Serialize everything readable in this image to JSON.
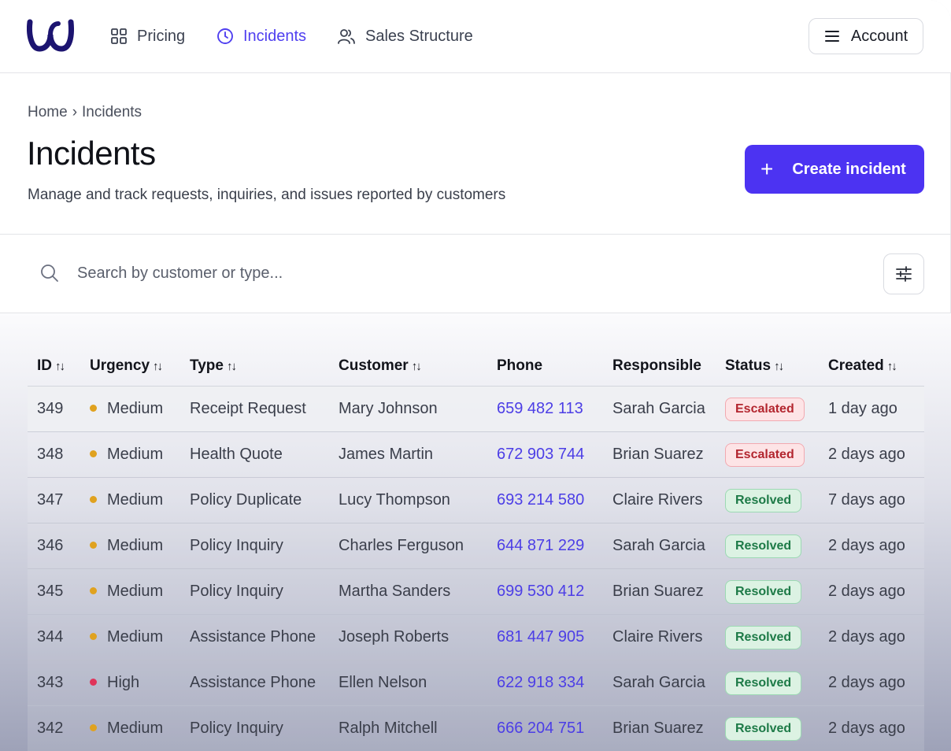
{
  "nav": {
    "items": [
      {
        "label": "Pricing",
        "icon": "grid-icon",
        "active": false
      },
      {
        "label": "Incidents",
        "icon": "clock-icon",
        "active": true
      },
      {
        "label": "Sales Structure",
        "icon": "users-icon",
        "active": false
      }
    ],
    "account_label": "Account"
  },
  "breadcrumb": {
    "home": "Home",
    "separator": "›",
    "current": "Incidents"
  },
  "page": {
    "title": "Incidents",
    "subtitle": "Manage and track requests, inquiries, and issues reported by customers",
    "create_label": "Create incident"
  },
  "search": {
    "placeholder": "Search by customer or type..."
  },
  "table": {
    "columns": {
      "id": "ID",
      "urgency": "Urgency",
      "type": "Type",
      "customer": "Customer",
      "phone": "Phone",
      "responsible": "Responsible",
      "status": "Status",
      "created": "Created"
    },
    "rows": [
      {
        "id": "349",
        "urgency": "Medium",
        "type": "Receipt Request",
        "customer": "Mary Johnson",
        "phone": "659 482 113",
        "responsible": "Sarah Garcia",
        "status": "Escalated",
        "created": "1 day ago"
      },
      {
        "id": "348",
        "urgency": "Medium",
        "type": "Health Quote",
        "customer": "James Martin",
        "phone": "672 903 744",
        "responsible": "Brian Suarez",
        "status": "Escalated",
        "created": "2 days ago"
      },
      {
        "id": "347",
        "urgency": "Medium",
        "type": "Policy Duplicate",
        "customer": "Lucy Thompson",
        "phone": "693 214 580",
        "responsible": "Claire Rivers",
        "status": "Resolved",
        "created": "7 days ago"
      },
      {
        "id": "346",
        "urgency": "Medium",
        "type": "Policy Inquiry",
        "customer": "Charles Ferguson",
        "phone": "644 871 229",
        "responsible": "Sarah Garcia",
        "status": "Resolved",
        "created": "2 days ago"
      },
      {
        "id": "345",
        "urgency": "Medium",
        "type": "Policy Inquiry",
        "customer": "Martha Sanders",
        "phone": "699 530 412",
        "responsible": "Brian Suarez",
        "status": "Resolved",
        "created": "2 days ago"
      },
      {
        "id": "344",
        "urgency": "Medium",
        "type": "Assistance Phone",
        "customer": "Joseph Roberts",
        "phone": "681 447 905",
        "responsible": "Claire Rivers",
        "status": "Resolved",
        "created": "2 days ago"
      },
      {
        "id": "343",
        "urgency": "High",
        "type": "Assistance Phone",
        "customer": "Ellen Nelson",
        "phone": "622 918 334",
        "responsible": "Sarah Garcia",
        "status": "Resolved",
        "created": "2 days ago"
      },
      {
        "id": "342",
        "urgency": "Medium",
        "type": "Policy Inquiry",
        "customer": "Ralph Mitchell",
        "phone": "666 204 751",
        "responsible": "Brian Suarez",
        "status": "Resolved",
        "created": "2 days ago"
      }
    ]
  },
  "colors": {
    "accent": "#4c33f2",
    "urgency_medium": "#e0a21f",
    "urgency_high": "#e0345a",
    "escalated": "#b3262f",
    "resolved": "#1d7a47"
  }
}
